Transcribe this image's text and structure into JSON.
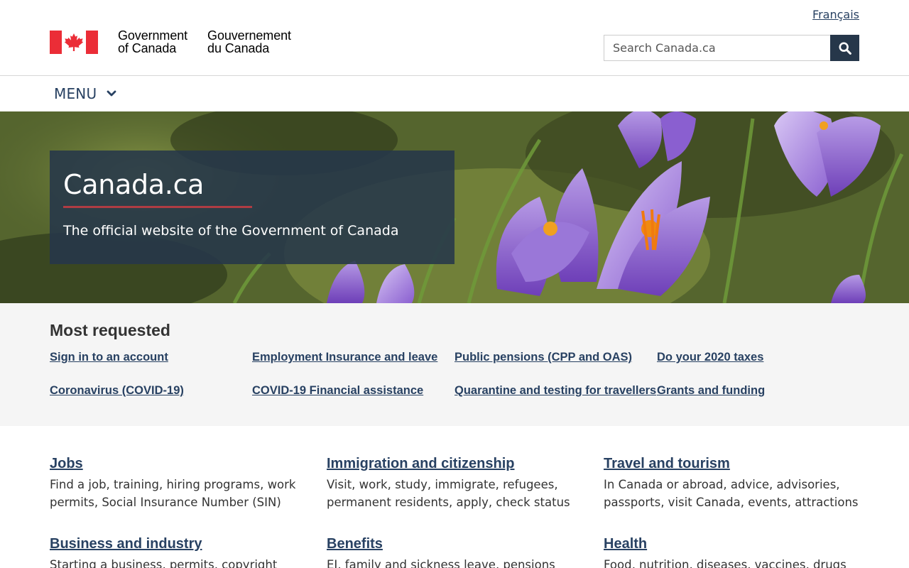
{
  "header": {
    "language_link": "Français",
    "signature_en_line1": "Government",
    "signature_en_line2": "of Canada",
    "signature_fr_line1": "Gouvernement",
    "signature_fr_line2": "du Canada",
    "search_placeholder": "Search Canada.ca",
    "search_icon": "search-icon",
    "flag_icon": "canada-flag-icon"
  },
  "menu": {
    "label": "MENU",
    "icon": "chevron-down-icon"
  },
  "hero": {
    "title": "Canada.ca",
    "subtitle": "The official website of the Government of Canada"
  },
  "most_requested": {
    "title": "Most requested",
    "links": [
      "Sign in to an account",
      "Employment Insurance and leave",
      "Public pensions (CPP and OAS)",
      "Do your 2020 taxes",
      "Coronavirus (COVID-19)",
      "COVID-19 Financial assistance",
      "Quarantine and testing for travellers",
      "Grants and funding"
    ]
  },
  "topics": [
    {
      "title": "Jobs",
      "description": "Find a job, training, hiring programs, work permits, Social Insurance Number (SIN)"
    },
    {
      "title": "Immigration and citizenship",
      "description": "Visit, work, study, immigrate, refugees, permanent residents, apply, check status"
    },
    {
      "title": "Travel and tourism",
      "description": "In Canada or abroad, advice, advisories, passports, visit Canada, events, attractions"
    },
    {
      "title": "Business and industry",
      "description": "Starting a business, permits, copyright"
    },
    {
      "title": "Benefits",
      "description": "EI, family and sickness leave, pensions"
    },
    {
      "title": "Health",
      "description": "Food, nutrition, diseases, vaccines, drugs"
    }
  ],
  "colors": {
    "link": "#284162",
    "dark_panel": "#26374a",
    "accent_red": "#af3c43",
    "flag_red": "#eb2d37"
  }
}
